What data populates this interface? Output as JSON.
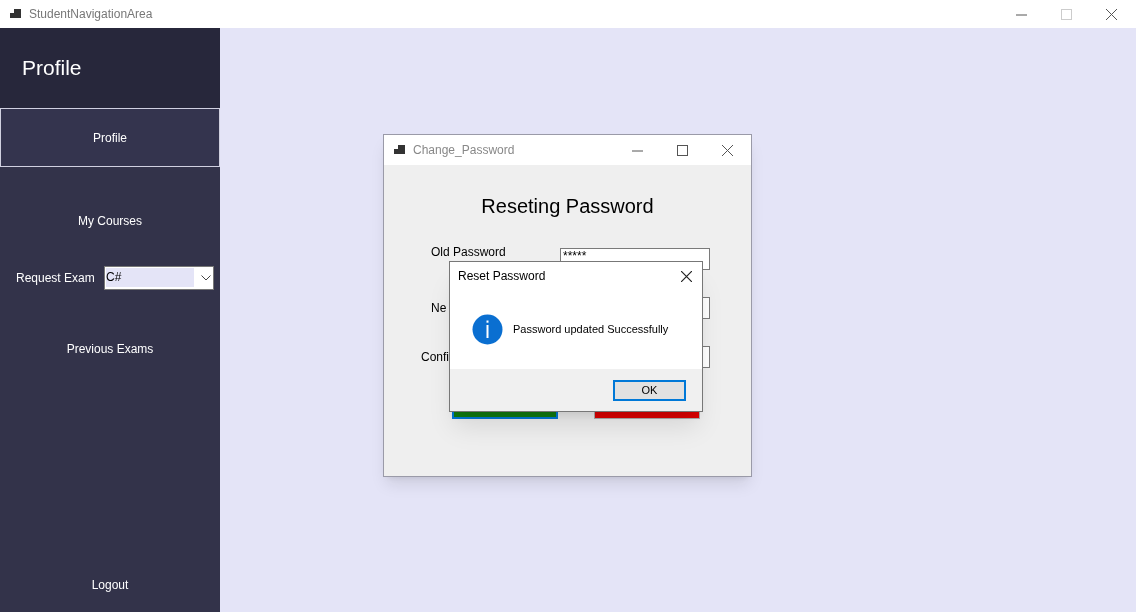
{
  "window": {
    "title": "StudentNavigationArea"
  },
  "sidebar": {
    "header": "Profile",
    "items": [
      {
        "kind": "button",
        "label": "Profile",
        "selected": true
      },
      {
        "kind": "button",
        "label": "My Courses",
        "selected": false
      },
      {
        "kind": "combo",
        "label": "Request Exam",
        "value": "C#",
        "selected": false
      },
      {
        "kind": "button",
        "label": "Previous Exams",
        "selected": false
      }
    ],
    "logout": "Logout"
  },
  "change_password": {
    "title": "Change_Password",
    "heading": "Reseting Password",
    "fields": [
      {
        "label": "Old Password",
        "value": "*****"
      },
      {
        "label": "Ne"
      },
      {
        "label": "Confi"
      }
    ],
    "buttons": [
      {
        "color": "#107c10"
      },
      {
        "color": "#e00000"
      }
    ]
  },
  "message_box": {
    "title": "Reset Password",
    "message": "Password updated Successfully",
    "button": "OK"
  }
}
